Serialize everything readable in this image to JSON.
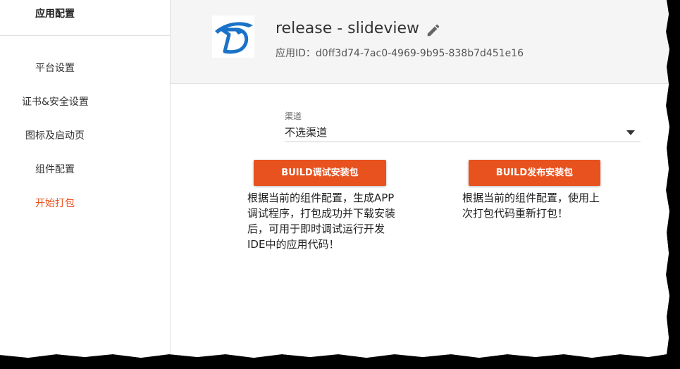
{
  "sidebar": {
    "header": "应用配置",
    "items": [
      {
        "label": "平台设置",
        "active": false
      },
      {
        "label": "证书&安全设置",
        "active": false
      },
      {
        "label": "图标及启动页",
        "active": false
      },
      {
        "label": "组件配置",
        "active": false
      },
      {
        "label": "开始打包",
        "active": true
      }
    ]
  },
  "app": {
    "title": "release - slideview",
    "id_label": "应用ID：d0ff3d74-7ac0-4969-9b95-838b7d451e16",
    "logo_icon": "app-logo-icon",
    "edit_icon": "pencil-icon"
  },
  "channel": {
    "label": "渠道",
    "value": "不选渠道"
  },
  "build": {
    "debug_label": "BUILD调试安装包",
    "debug_desc": "根据当前的组件配置，生成APP调试程序，打包成功并下载安装后，可用于即时调试运行开发IDE中的应用代码！",
    "release_label": "BUILD发布安装包",
    "release_desc": "根据当前的组件配置，使用上次打包代码重新打包！"
  },
  "colors": {
    "accent": "#e8521f",
    "logo_blue": "#1a73c8"
  }
}
